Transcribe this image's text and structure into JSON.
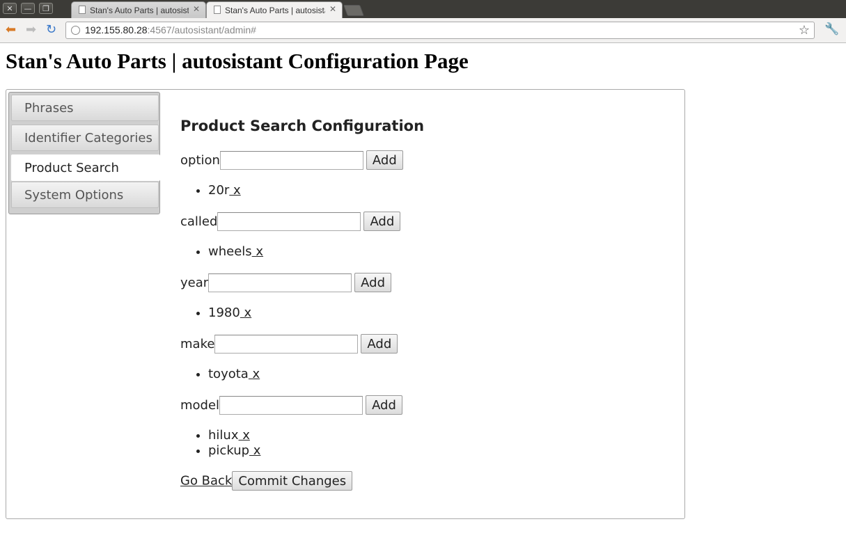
{
  "window": {
    "controls": {
      "close": "✕",
      "minimize": "—",
      "maximize": "❐"
    },
    "tabs": [
      {
        "title": "Stan's Auto Parts | autosistant",
        "close": "✕"
      },
      {
        "title": "Stan's Auto Parts | autosistant",
        "close": "✕"
      }
    ]
  },
  "toolbar": {
    "back_icon": "arrow-left-icon",
    "forward_icon": "arrow-right-icon",
    "reload_icon": "reload-icon",
    "url_host": "192.155.80.28",
    "url_rest": ":4567/autosistant/admin#",
    "bookmark_icon": "star-icon",
    "menu_icon": "wrench-icon"
  },
  "page": {
    "title": "Stan's Auto Parts | autosistant Configuration Page"
  },
  "sidebar": {
    "items": [
      {
        "label": "Phrases"
      },
      {
        "label": "Identifier Categories"
      },
      {
        "label": "Product Search"
      },
      {
        "label": "System Options"
      }
    ],
    "active": "Product Search"
  },
  "main": {
    "heading": "Product Search Configuration",
    "add_label": "Add",
    "remove_label": " x",
    "fields": [
      {
        "label": "option",
        "value": "",
        "items": [
          "20r"
        ]
      },
      {
        "label": "called",
        "value": "",
        "items": [
          "wheels"
        ]
      },
      {
        "label": "year",
        "value": "",
        "items": [
          "1980"
        ]
      },
      {
        "label": "make",
        "value": "",
        "items": [
          "toyota"
        ]
      },
      {
        "label": "model",
        "value": "",
        "items": [
          "hilux",
          "pickup"
        ]
      }
    ],
    "go_back": "Go Back",
    "commit": "Commit Changes"
  }
}
